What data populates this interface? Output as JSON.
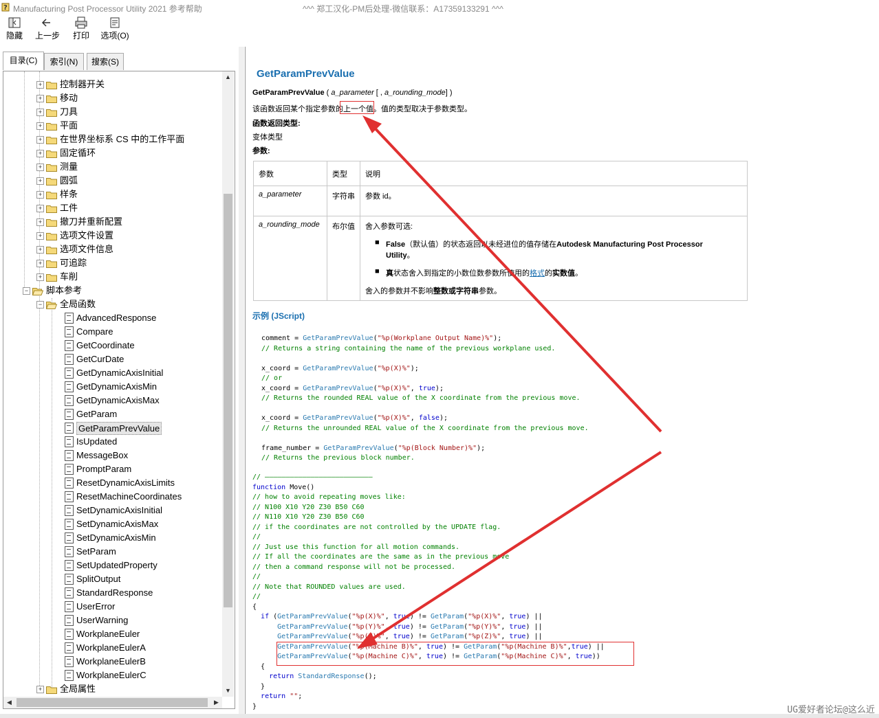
{
  "window": {
    "title": "Manufacturing Post Processor Utility 2021 参考帮助",
    "center_text": "^^^     郑工汉化-PM后处理-微信联系：A17359133291     ^^^"
  },
  "toolbar": {
    "hide": "隐藏",
    "back": "上一步",
    "print": "打印",
    "options": "选项(O)"
  },
  "tabs": {
    "contents": "目录(C)",
    "index": "索引(N)",
    "search": "搜索(S)"
  },
  "tree": {
    "folders": [
      "控制器开关",
      "移动",
      "刀具",
      "平面",
      "在世界坐标系 CS 中的工作平面",
      "固定循环",
      "测量",
      "圆弧",
      "样条",
      "工件",
      "撤刀并重新配置",
      "选项文件设置",
      "选项文件信息",
      "可追踪",
      "车削"
    ],
    "script_ref": "脚本参考",
    "global_funcs": "全局函数",
    "functions": [
      "AdvancedResponse",
      "Compare",
      "GetCoordinate",
      "GetCurDate",
      "GetDynamicAxisInitial",
      "GetDynamicAxisMin",
      "GetDynamicAxisMax",
      "GetParam",
      "GetParamPrevValue",
      "IsUpdated",
      "MessageBox",
      "PromptParam",
      "ResetDynamicAxisLimits",
      "ResetMachineCoordinates",
      "SetDynamicAxisInitial",
      "SetDynamicAxisMax",
      "SetDynamicAxisMin",
      "SetParam",
      "SetUpdatedProperty",
      "SplitOutput",
      "StandardResponse",
      "UserError",
      "UserWarning",
      "WorkplaneEuler",
      "WorkplaneEulerA",
      "WorkplaneEulerB",
      "WorkplaneEulerC"
    ],
    "global_props": "全局属性"
  },
  "doc": {
    "heading": "GetParamPrevValue",
    "sig_name": "GetParamPrevValue",
    "sig_open": " ( ",
    "sig_p1": "a_parameter",
    "sig_mid": " [ , ",
    "sig_p2": "a_rounding_mode",
    "sig_close": "] )",
    "desc_a": "该函数返回某个指定参数的",
    "desc_b": "上一个值",
    "desc_c": "。值的类型取决于参数类型。",
    "return_label": "函数返回类型:",
    "return_value": "变体类型",
    "params_label": "参数:",
    "table": {
      "h_param": "参数",
      "h_type": "类型",
      "h_desc": "说明",
      "r1_param": "a_parameter",
      "r1_type": "字符串",
      "r1_desc": "参数 id。",
      "r2_param": "a_rounding_mode",
      "r2_type": "布尔值",
      "r2_intro": "舍入参数可选:",
      "r2_b1_bold": "False",
      "r2_b1_text": "（默认值）的状态返回以未经进位的值存储在",
      "r2_b1_bold2": "Autodesk Manufacturing Post Processor Utility",
      "r2_b1_end": "。",
      "r2_b2_bold": "真",
      "r2_b2_text": "状态舍入到指定的小数位数参数所使用的",
      "r2_b2_link": "格式",
      "r2_b2_text2": "的",
      "r2_b2_bold2": "实数值",
      "r2_b2_end": "。",
      "r2_note_a": "舍入的参数并不影响",
      "r2_note_b": "整数或字符串",
      "r2_note_c": "参数。"
    },
    "example_title": "示例 (JScript)"
  },
  "code": {
    "c1": "comment",
    "l1_fn": "GetParamPrevValue",
    "l1_str": "\"%p(Workplane Output Name)%\"",
    "l2": "// Returns a string containing the name of the previous workplane used.",
    "l3_var": "x_coord",
    "l3_str": "\"%p(X)%\"",
    "l4": "// or",
    "l5_true": "true",
    "l6": "// Returns the rounded REAL value of the X coordinate from the previous move.",
    "l7_false": "false",
    "l8": "// Returns the unrounded REAL value of the X coordinate from the previous move.",
    "l9_var": "frame_number",
    "l9_str": "\"%p(Block Number)%\"",
    "l10": "// Returns the previous block number.",
    "sep": "// ——————————————————————————",
    "func_kw": "function",
    "func_name": " Move()",
    "cm1": "// how to avoid repeating moves like:",
    "cm2": "// N100 X10 Y20 Z30 B50 C60",
    "cm3": "// N110 X10 Y20 Z30 B50 C60",
    "cm4": "// if the coordinates are not controlled by the UPDATE flag.",
    "cm5": "//",
    "cm6": "// Just use this function for all motion commands.",
    "cm7": "// If all the coordinates are the same as in the previous move",
    "cm8": "// then a command response will not be processed.",
    "cm9": "//",
    "cm10": "// Note that ROUNDED values are used.",
    "cm11": "//",
    "if_kw": "if",
    "fn_get": "GetParam",
    "sy": "\"%p(Y)%\"",
    "sz": "\"%p(Z)%\"",
    "smb": "\"%p(Machine B)%\"",
    "smc": "\"%p(Machine C)%\"",
    "ret_kw": "return",
    "std_resp": "StandardResponse",
    "ret_str": "\"\""
  },
  "watermark": "UG爱好者论坛@这么近",
  "colors": {
    "accent": "#1a6fb0",
    "annotation": "#e03030",
    "comment": "#008000"
  }
}
